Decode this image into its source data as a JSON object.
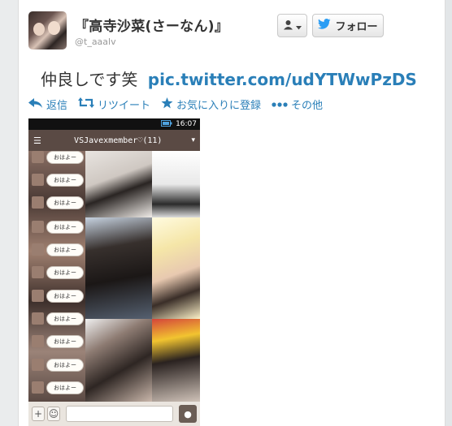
{
  "profile": {
    "display_name": "『高寺沙菜(さーなん)』",
    "handle": "@t_aaalv"
  },
  "buttons": {
    "user_menu_icon": "person-icon",
    "follow_label": "フォロー"
  },
  "tweet": {
    "text": "仲良しです笑",
    "link": "pic.twitter.com/udYTWwPzDS"
  },
  "actions": [
    {
      "icon": "reply-icon",
      "label": "返信"
    },
    {
      "icon": "retweet-icon",
      "label": "リツイート"
    },
    {
      "icon": "star-icon",
      "label": "お気に入りに登録"
    },
    {
      "icon": "more-icon",
      "label": "その他"
    }
  ],
  "photo": {
    "status_time": "16:07",
    "chat_title": "VSJavexmember♡(11)",
    "bubble_text": "おはよー"
  },
  "colors": {
    "link": "#2a7fb8",
    "text": "#333333",
    "handle": "#999999"
  }
}
